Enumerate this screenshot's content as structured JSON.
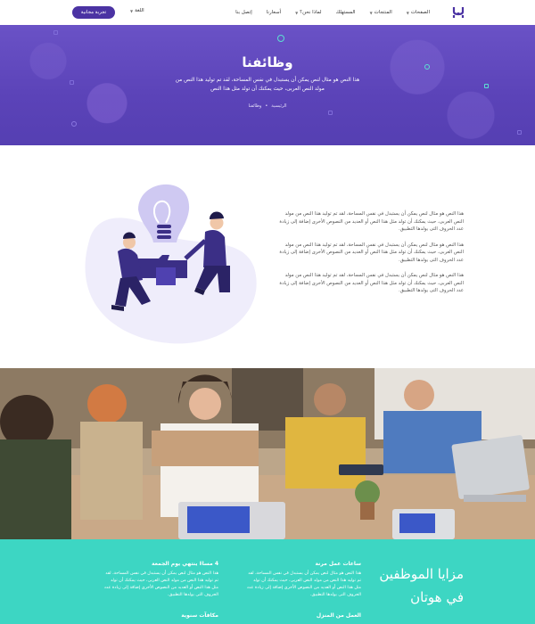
{
  "nav": {
    "menu": [
      {
        "label": "الصفحات",
        "dropdown": true
      },
      {
        "label": "المنتجات",
        "dropdown": true
      },
      {
        "label": "المستهلك",
        "dropdown": false
      },
      {
        "label": "لماذا نحن؟",
        "dropdown": true
      },
      {
        "label": "أسعارنا",
        "dropdown": false
      },
      {
        "label": "إتصل بنا",
        "dropdown": false
      }
    ],
    "lang": "اللغة",
    "cta": "تجربة مجانية"
  },
  "hero": {
    "title": "وظائفنا",
    "desc": "هذا النص هو مثال لنص يمكن أن يستبدل في نفس المساحة، لقد تم توليد هذا النص من مولد النص العربى، حيث يمكنك أن تولد مثل هذا النص",
    "crumbs": {
      "home": "الرئيسية",
      "sep": "•",
      "current": "وظائفنا"
    }
  },
  "about": {
    "paragraphs": [
      "هذا النص هو مثال لنص يمكن أن يستبدل في نفس المساحة، لقد تم توليد هذا النص من مولد النص العربى، حيث يمكنك أن تولد مثل هذا النص أو العديد من النصوص الأخرى إضافة إلى زيادة عدد الحروف التى يولدها التطبيق.",
      "هذا النص هو مثال لنص يمكن أن يستبدل في نفس المساحة، لقد تم توليد هذا النص من مولد النص العربى، حيث يمكنك أن تولد مثل هذا النص أو العديد من النصوص الأخرى إضافة إلى زيادة عدد الحروف التى يولدها التطبيق.",
      "هذا النص هو مثال لنص يمكن أن يستبدل في نفس المساحة، لقد تم توليد هذا النص من مولد النص العربى، حيث يمكنك أن تولد مثل هذا النص أو العديد من النصوص الأخرى إضافة إلى زيادة عدد الحروف التى يولدها التطبيق."
    ]
  },
  "benefits": {
    "title": "مزايا الموظفين في هوتان",
    "items": [
      {
        "title": "ساعات عمل مرنة",
        "text": "هذا النص هو مثال لنص يمكن أن يستبدل في نفس المساحة، لقد تم توليد هذا النص من مولد النص العربى، حيث يمكنك أن تولد مثل هذا النص أو العديد من النصوص الأخرى إضافة إلى زيادة عدد الحروف التى يولدها التطبيق."
      },
      {
        "title": "4 مساءً ينتهي يوم الجمعة",
        "text": "هذا النص هو مثال لنص يمكن أن يستبدل في نفس المساحة، لقد تم توليد هذا النص من مولد النص العربى، حيث يمكنك أن تولد مثل هذا النص أو العديد من النصوص الأخرى إضافة إلى زيادة عدد الحروف التى يولدها التطبيق."
      },
      {
        "title": "العمل من المنزل",
        "text": ""
      },
      {
        "title": "مكافآت سنوية",
        "text": ""
      }
    ]
  },
  "colors": {
    "brand": "#4b33a3",
    "hero": "#5b43b8",
    "teal": "#3dd6c3"
  },
  "icons": {
    "logo": "hootan-logo",
    "dropdown": "chevron-down-icon"
  }
}
